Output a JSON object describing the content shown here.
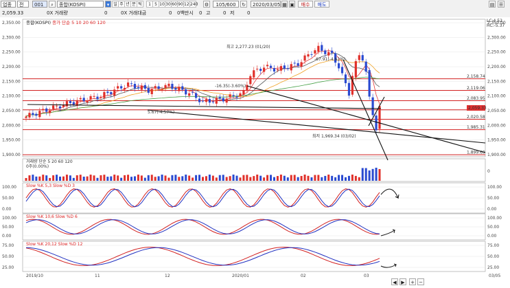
{
  "toolbar": {
    "type_select": "업종",
    "period_select": "전",
    "code_field": "001",
    "index_name": "종합(KOSPI)",
    "period_buttons": [
      "일",
      "주",
      "년",
      "분",
      "틱"
    ],
    "minute_buttons": [
      "1",
      "5",
      "10",
      "30",
      "60",
      "90",
      "120",
      "240"
    ],
    "count_display": "105/600",
    "date_field": "2020/03/05",
    "buy_button": "매수",
    "sell_button": "매도"
  },
  "infobar": {
    "price": "2,059.33",
    "volume_label": "0X 거래량",
    "volume_value": "0",
    "amount_label": "0X 거래대금",
    "amount_value": "0",
    "amount_unit": "0백만시",
    "ohlc": [
      {
        "label": "0",
        "value": "고"
      },
      {
        "label": "0",
        "value": "저"
      },
      {
        "label": "0",
        "value": ""
      }
    ]
  },
  "price_pane": {
    "title": "종합(KOSPI)",
    "ma_legend": "종가 단순 5 10 20 60 120",
    "ma_colors": [
      "#e33b3b",
      "#555555",
      "#f0a020",
      "#47a047",
      "#9b5cc4"
    ],
    "top_right_labels": [
      "LC:4.52",
      "HC:-5.37"
    ],
    "y_ticks": [
      "2,350.00",
      "2,300.00",
      "2,250.00",
      "2,200.00",
      "2,150.00",
      "2,100.00",
      "2,050.00",
      "2,000.00",
      "1,950.00",
      "1,900.00"
    ],
    "price_levels": [
      "2,158.74",
      "2,119.06",
      "2,083.95",
      "2,052.92",
      "2,020.58",
      "1,985.31",
      "1,899.69"
    ],
    "current_price_tag": "2,059.33",
    "annotations": {
      "high": "최고 2,277.23 (01/20)",
      "low": "최저 1,969.34 (03/02)",
      "drop": "-16.35(-3.60%)",
      "rise1": "5.67(-4.57%)",
      "rise2": "-67.91(-4.61%)"
    }
  },
  "volume_pane": {
    "title": "거래량 단순 5 20 60 120",
    "sub": "0주(0.00%)",
    "right_tick": "0"
  },
  "stoch_panes": [
    {
      "title": "Slow %K 5,3  Slow %D 3",
      "ticks": [
        "100.00",
        "50.00",
        "0.00"
      ]
    },
    {
      "title": "Slow %K 10,6  Slow %D 6",
      "ticks": [
        "100.00",
        "50.00",
        "0.00"
      ]
    },
    {
      "title": "Slow %K 20,12  Slow %D 12",
      "ticks": [
        "75.00",
        "50.00",
        "25.00"
      ]
    }
  ],
  "x_axis": [
    "2019/10",
    "11",
    "12",
    "2020/01",
    "02",
    "03",
    "03/05"
  ],
  "colors": {
    "up": "#e0302a",
    "down": "#2a4ad0",
    "level_line": "#d22020",
    "trend": "#111111"
  }
}
